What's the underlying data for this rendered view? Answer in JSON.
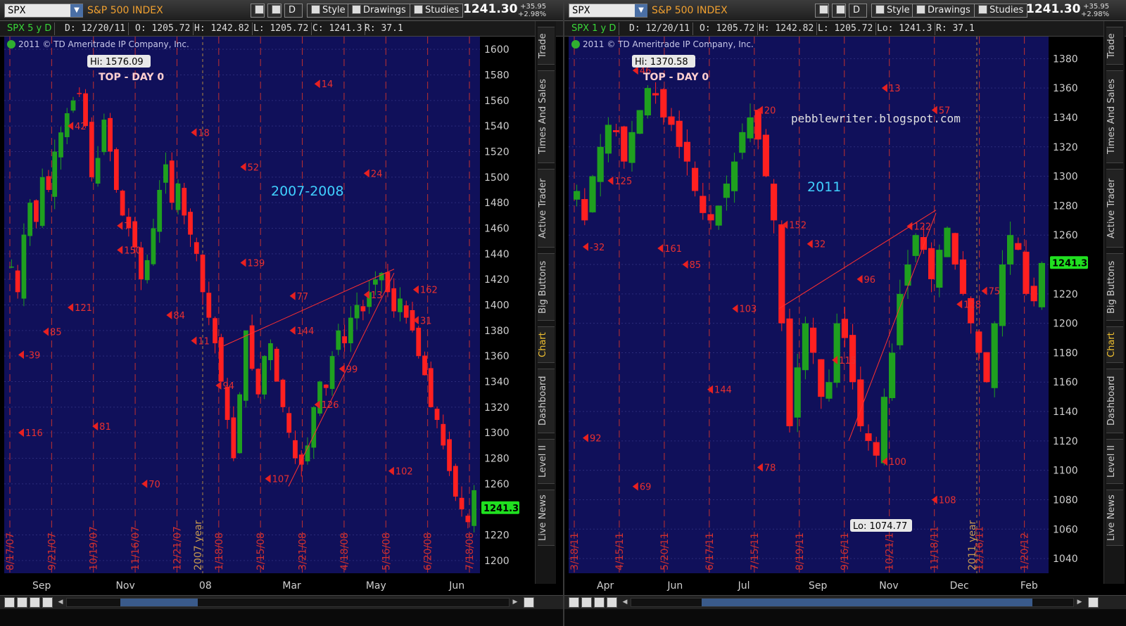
{
  "panels": [
    {
      "symbol": "SPX",
      "index_name": "S&P 500 INDEX",
      "toolbar": {
        "style": "Style",
        "drawings": "Drawings",
        "studies": "Studies",
        "d": "D"
      },
      "last": "1241.30",
      "change": "+35.95",
      "change_pct": "+2.98%",
      "info": {
        "sym": "SPX 5 y D",
        "d": "D: 12/20/11",
        "o": "O: 1205.72",
        "h": "H: 1242.82",
        "l": "L: 1205.72",
        "c": "C: 1241.3",
        "r": "R: 37.1"
      },
      "copyright": "2011 © TD Ameritrade IP Company, Inc.",
      "price_tag": "1241.3"
    },
    {
      "symbol": "SPX",
      "index_name": "S&P 500 INDEX",
      "toolbar": {
        "style": "Style",
        "drawings": "Drawings",
        "studies": "Studies",
        "d": "D"
      },
      "last": "1241.30",
      "change": "+35.95",
      "change_pct": "+2.98%",
      "info": {
        "sym": "SPX 1 y D",
        "d": "D: 12/20/11",
        "o": "O: 1205.72",
        "h": "H: 1242.82",
        "l": "L: 1205.72",
        "c": "Lo: 1241.3",
        "r": "R: 37.1"
      },
      "copyright": "2011 © TD Ameritrade IP Company, Inc.",
      "price_tag": "1241.3"
    }
  ],
  "side_tabs": [
    "Trade",
    "Times And Sales",
    "Active Trader",
    "Big Buttons",
    "Chart",
    "Dashboard",
    "Level II",
    "Live News"
  ],
  "chart_data": [
    {
      "type": "candlestick",
      "title": "2007-2008",
      "ylim": [
        1190,
        1610
      ],
      "yticks": [
        1200,
        1220,
        1240,
        1260,
        1280,
        1300,
        1320,
        1340,
        1360,
        1380,
        1400,
        1420,
        1440,
        1460,
        1480,
        1500,
        1520,
        1540,
        1560,
        1580,
        1600
      ],
      "xlabels": [
        "Sep",
        "Nov",
        "08",
        "Mar",
        "May",
        "Jun"
      ],
      "vlines": [
        "8/17/07",
        "9/21/07",
        "10/19/07",
        "11/16/07",
        "12/21/07",
        "1/18/08",
        "2/15/08",
        "3/21/08",
        "4/18/08",
        "5/16/08",
        "6/20/08",
        "7/18/08"
      ],
      "year_marker": "2007 year",
      "hi_label": "Hi: 1576.09",
      "top_label": "TOP - DAY 0",
      "close_series": [
        1430,
        1410,
        1455,
        1480,
        1465,
        1500,
        1490,
        1520,
        1535,
        1550,
        1560,
        1565,
        1540,
        1500,
        1515,
        1545,
        1520,
        1490,
        1470,
        1460,
        1445,
        1420,
        1435,
        1460,
        1490,
        1510,
        1480,
        1495,
        1470,
        1455,
        1440,
        1410,
        1390,
        1370,
        1340,
        1310,
        1280,
        1330,
        1380,
        1350,
        1330,
        1360,
        1370,
        1340,
        1320,
        1300,
        1280,
        1275,
        1290,
        1320,
        1340,
        1335,
        1360,
        1380,
        1370,
        1390,
        1400,
        1395,
        1410,
        1420,
        1425,
        1410,
        1395,
        1405,
        1390,
        1380,
        1360,
        1345,
        1320,
        1310,
        1290,
        1270,
        1250,
        1240,
        1230,
        1255
      ],
      "day_counts": [
        {
          "label": "-39",
          "price": 1361
        },
        {
          "label": "14",
          "price": 1573
        },
        {
          "label": "18",
          "price": 1535
        },
        {
          "label": "42",
          "price": 1540
        },
        {
          "label": "24",
          "price": 1503
        },
        {
          "label": "52",
          "price": 1508
        },
        {
          "label": "7",
          "price": 1462
        },
        {
          "label": "31",
          "price": 1388
        },
        {
          "label": "77",
          "price": 1407
        },
        {
          "label": "84",
          "price": 1392
        },
        {
          "label": "85",
          "price": 1379
        },
        {
          "label": "99",
          "price": 1350
        },
        {
          "label": "94",
          "price": 1337
        },
        {
          "label": "81",
          "price": 1305
        },
        {
          "label": "102",
          "price": 1270
        },
        {
          "label": "107",
          "price": 1264
        },
        {
          "label": "70",
          "price": 1260
        },
        {
          "label": "116",
          "price": 1300
        },
        {
          "label": "126",
          "price": 1322
        },
        {
          "label": "11",
          "price": 1372
        },
        {
          "label": "121",
          "price": 1398
        },
        {
          "label": "13",
          "price": 1408
        },
        {
          "label": "139",
          "price": 1433
        },
        {
          "label": "150",
          "price": 1443
        },
        {
          "label": "162",
          "price": 1412
        },
        {
          "label": "144",
          "price": 1380
        }
      ],
      "price_tag": "1241.3"
    },
    {
      "type": "candlestick",
      "title": "2011",
      "ylim": [
        1030,
        1395
      ],
      "yticks": [
        1040,
        1060,
        1080,
        1100,
        1120,
        1140,
        1160,
        1180,
        1200,
        1220,
        1240,
        1260,
        1280,
        1300,
        1320,
        1340,
        1360,
        1380
      ],
      "xlabels": [
        "Apr",
        "Jun",
        "Jul",
        "Sep",
        "Nov",
        "Dec",
        "Feb"
      ],
      "vlines": [
        "3/18/11",
        "4/15/11",
        "5/20/11",
        "6/17/11",
        "7/15/11",
        "8/19/11",
        "9/16/11",
        "10/21/11",
        "11/18/11",
        "12/16/11",
        "1/20/12"
      ],
      "year_marker": "2011 year",
      "hi_label": "Hi: 1370.58",
      "lo_label": "Lo: 1074.77",
      "top_label": "TOP - DAY 0",
      "watermark": "pebblewriter.blogspot.com",
      "close_series": [
        1290,
        1270,
        1300,
        1320,
        1335,
        1330,
        1310,
        1330,
        1345,
        1360,
        1355,
        1340,
        1335,
        1320,
        1310,
        1290,
        1275,
        1270,
        1280,
        1295,
        1310,
        1330,
        1340,
        1325,
        1300,
        1270,
        1200,
        1130,
        1170,
        1200,
        1180,
        1150,
        1160,
        1200,
        1190,
        1160,
        1130,
        1120,
        1110,
        1150,
        1180,
        1220,
        1240,
        1260,
        1250,
        1230,
        1250,
        1265,
        1240,
        1220,
        1200,
        1180,
        1160,
        1200,
        1240,
        1260,
        1250,
        1220,
        1215,
        1241
      ],
      "day_counts": [
        {
          "label": "-32",
          "price": 1252
        },
        {
          "label": "13",
          "price": 1360
        },
        {
          "label": "20",
          "price": 1345
        },
        {
          "label": "46",
          "price": 1372
        },
        {
          "label": "57",
          "price": 1345
        },
        {
          "label": "32",
          "price": 1254
        },
        {
          "label": "85",
          "price": 1240
        },
        {
          "label": "75",
          "price": 1222
        },
        {
          "label": "96",
          "price": 1230
        },
        {
          "label": "103",
          "price": 1210
        },
        {
          "label": "125",
          "price": 1297
        },
        {
          "label": "122",
          "price": 1266
        },
        {
          "label": "152",
          "price": 1267
        },
        {
          "label": "161",
          "price": 1251
        },
        {
          "label": "128",
          "price": 1213
        },
        {
          "label": "115",
          "price": 1175
        },
        {
          "label": "144",
          "price": 1155
        },
        {
          "label": "92",
          "price": 1122
        },
        {
          "label": "100",
          "price": 1106
        },
        {
          "label": "78",
          "price": 1102
        },
        {
          "label": "69",
          "price": 1089
        },
        {
          "label": "108",
          "price": 1080
        }
      ],
      "price_tag": "1241.3"
    }
  ]
}
